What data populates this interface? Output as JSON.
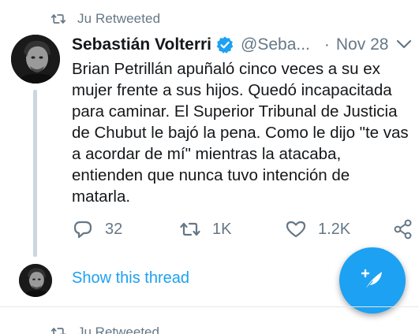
{
  "retweet_context": {
    "icon": "retweet-icon",
    "text": "Ju Retweeted"
  },
  "tweet": {
    "display_name": "Sebastián Volterri",
    "verified": true,
    "handle": "@Seba...",
    "separator": "·",
    "date": "Nov 28",
    "text_lines": [
      "Brian Petrillán apuñaló cinco veces a su ex",
      "mujer frente a sus hijos. Quedó incapacitada",
      "para caminar. El Superior Tribunal de Justicia",
      "de Chubut le bajó la pena. Como le dijo \"te vas",
      "a acordar de mí\" mientras la atacaba,",
      "entienden que nunca tuvo intención de",
      "matarla."
    ],
    "actions": {
      "reply_count": "32",
      "retweet_count": "1K",
      "like_count": "1.2K"
    }
  },
  "thread": {
    "show_thread_label": "Show this thread"
  },
  "next_item": {
    "retweet_text": "Ju Retweeted"
  },
  "colors": {
    "accent": "#1da1f2",
    "verified_badge": "#1da1f2",
    "muted_text": "#657786",
    "primary_text": "#14171a",
    "thread_line": "#ccd6dd",
    "divider": "#e1e8ed"
  }
}
